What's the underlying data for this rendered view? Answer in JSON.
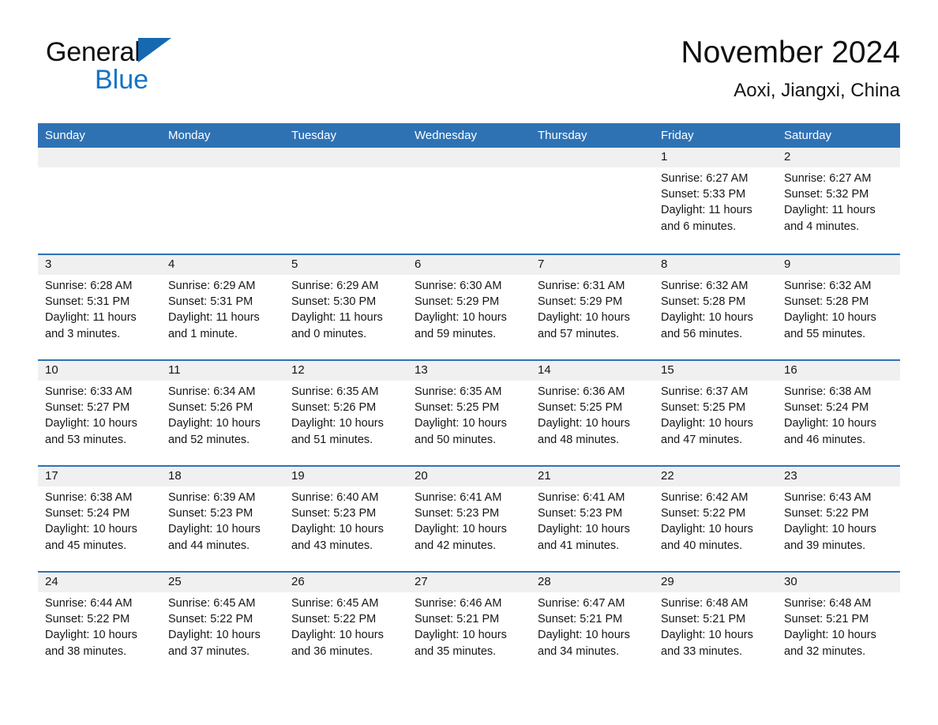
{
  "logo": {
    "word_general": "General",
    "word_blue": "Blue",
    "triangle_color": "#1669b0",
    "blue_color": "#1473c6"
  },
  "header": {
    "title": "November 2024",
    "subtitle": "Aoxi, Jiangxi, China"
  },
  "theme": {
    "header_blue": "#2f72b4",
    "band_gray": "#f0f0f0",
    "text": "#161616",
    "page_bg": "#ffffff"
  },
  "calendar": {
    "weekdays": [
      "Sunday",
      "Monday",
      "Tuesday",
      "Wednesday",
      "Thursday",
      "Friday",
      "Saturday"
    ],
    "weeks": [
      [
        {
          "day": "",
          "sunrise": "",
          "sunset": "",
          "daylight": ""
        },
        {
          "day": "",
          "sunrise": "",
          "sunset": "",
          "daylight": ""
        },
        {
          "day": "",
          "sunrise": "",
          "sunset": "",
          "daylight": ""
        },
        {
          "day": "",
          "sunrise": "",
          "sunset": "",
          "daylight": ""
        },
        {
          "day": "",
          "sunrise": "",
          "sunset": "",
          "daylight": ""
        },
        {
          "day": "1",
          "sunrise": "Sunrise: 6:27 AM",
          "sunset": "Sunset: 5:33 PM",
          "daylight": "Daylight: 11 hours and 6 minutes."
        },
        {
          "day": "2",
          "sunrise": "Sunrise: 6:27 AM",
          "sunset": "Sunset: 5:32 PM",
          "daylight": "Daylight: 11 hours and 4 minutes."
        }
      ],
      [
        {
          "day": "3",
          "sunrise": "Sunrise: 6:28 AM",
          "sunset": "Sunset: 5:31 PM",
          "daylight": "Daylight: 11 hours and 3 minutes."
        },
        {
          "day": "4",
          "sunrise": "Sunrise: 6:29 AM",
          "sunset": "Sunset: 5:31 PM",
          "daylight": "Daylight: 11 hours and 1 minute."
        },
        {
          "day": "5",
          "sunrise": "Sunrise: 6:29 AM",
          "sunset": "Sunset: 5:30 PM",
          "daylight": "Daylight: 11 hours and 0 minutes."
        },
        {
          "day": "6",
          "sunrise": "Sunrise: 6:30 AM",
          "sunset": "Sunset: 5:29 PM",
          "daylight": "Daylight: 10 hours and 59 minutes."
        },
        {
          "day": "7",
          "sunrise": "Sunrise: 6:31 AM",
          "sunset": "Sunset: 5:29 PM",
          "daylight": "Daylight: 10 hours and 57 minutes."
        },
        {
          "day": "8",
          "sunrise": "Sunrise: 6:32 AM",
          "sunset": "Sunset: 5:28 PM",
          "daylight": "Daylight: 10 hours and 56 minutes."
        },
        {
          "day": "9",
          "sunrise": "Sunrise: 6:32 AM",
          "sunset": "Sunset: 5:28 PM",
          "daylight": "Daylight: 10 hours and 55 minutes."
        }
      ],
      [
        {
          "day": "10",
          "sunrise": "Sunrise: 6:33 AM",
          "sunset": "Sunset: 5:27 PM",
          "daylight": "Daylight: 10 hours and 53 minutes."
        },
        {
          "day": "11",
          "sunrise": "Sunrise: 6:34 AM",
          "sunset": "Sunset: 5:26 PM",
          "daylight": "Daylight: 10 hours and 52 minutes."
        },
        {
          "day": "12",
          "sunrise": "Sunrise: 6:35 AM",
          "sunset": "Sunset: 5:26 PM",
          "daylight": "Daylight: 10 hours and 51 minutes."
        },
        {
          "day": "13",
          "sunrise": "Sunrise: 6:35 AM",
          "sunset": "Sunset: 5:25 PM",
          "daylight": "Daylight: 10 hours and 50 minutes."
        },
        {
          "day": "14",
          "sunrise": "Sunrise: 6:36 AM",
          "sunset": "Sunset: 5:25 PM",
          "daylight": "Daylight: 10 hours and 48 minutes."
        },
        {
          "day": "15",
          "sunrise": "Sunrise: 6:37 AM",
          "sunset": "Sunset: 5:25 PM",
          "daylight": "Daylight: 10 hours and 47 minutes."
        },
        {
          "day": "16",
          "sunrise": "Sunrise: 6:38 AM",
          "sunset": "Sunset: 5:24 PM",
          "daylight": "Daylight: 10 hours and 46 minutes."
        }
      ],
      [
        {
          "day": "17",
          "sunrise": "Sunrise: 6:38 AM",
          "sunset": "Sunset: 5:24 PM",
          "daylight": "Daylight: 10 hours and 45 minutes."
        },
        {
          "day": "18",
          "sunrise": "Sunrise: 6:39 AM",
          "sunset": "Sunset: 5:23 PM",
          "daylight": "Daylight: 10 hours and 44 minutes."
        },
        {
          "day": "19",
          "sunrise": "Sunrise: 6:40 AM",
          "sunset": "Sunset: 5:23 PM",
          "daylight": "Daylight: 10 hours and 43 minutes."
        },
        {
          "day": "20",
          "sunrise": "Sunrise: 6:41 AM",
          "sunset": "Sunset: 5:23 PM",
          "daylight": "Daylight: 10 hours and 42 minutes."
        },
        {
          "day": "21",
          "sunrise": "Sunrise: 6:41 AM",
          "sunset": "Sunset: 5:23 PM",
          "daylight": "Daylight: 10 hours and 41 minutes."
        },
        {
          "day": "22",
          "sunrise": "Sunrise: 6:42 AM",
          "sunset": "Sunset: 5:22 PM",
          "daylight": "Daylight: 10 hours and 40 minutes."
        },
        {
          "day": "23",
          "sunrise": "Sunrise: 6:43 AM",
          "sunset": "Sunset: 5:22 PM",
          "daylight": "Daylight: 10 hours and 39 minutes."
        }
      ],
      [
        {
          "day": "24",
          "sunrise": "Sunrise: 6:44 AM",
          "sunset": "Sunset: 5:22 PM",
          "daylight": "Daylight: 10 hours and 38 minutes."
        },
        {
          "day": "25",
          "sunrise": "Sunrise: 6:45 AM",
          "sunset": "Sunset: 5:22 PM",
          "daylight": "Daylight: 10 hours and 37 minutes."
        },
        {
          "day": "26",
          "sunrise": "Sunrise: 6:45 AM",
          "sunset": "Sunset: 5:22 PM",
          "daylight": "Daylight: 10 hours and 36 minutes."
        },
        {
          "day": "27",
          "sunrise": "Sunrise: 6:46 AM",
          "sunset": "Sunset: 5:21 PM",
          "daylight": "Daylight: 10 hours and 35 minutes."
        },
        {
          "day": "28",
          "sunrise": "Sunrise: 6:47 AM",
          "sunset": "Sunset: 5:21 PM",
          "daylight": "Daylight: 10 hours and 34 minutes."
        },
        {
          "day": "29",
          "sunrise": "Sunrise: 6:48 AM",
          "sunset": "Sunset: 5:21 PM",
          "daylight": "Daylight: 10 hours and 33 minutes."
        },
        {
          "day": "30",
          "sunrise": "Sunrise: 6:48 AM",
          "sunset": "Sunset: 5:21 PM",
          "daylight": "Daylight: 10 hours and 32 minutes."
        }
      ]
    ]
  }
}
